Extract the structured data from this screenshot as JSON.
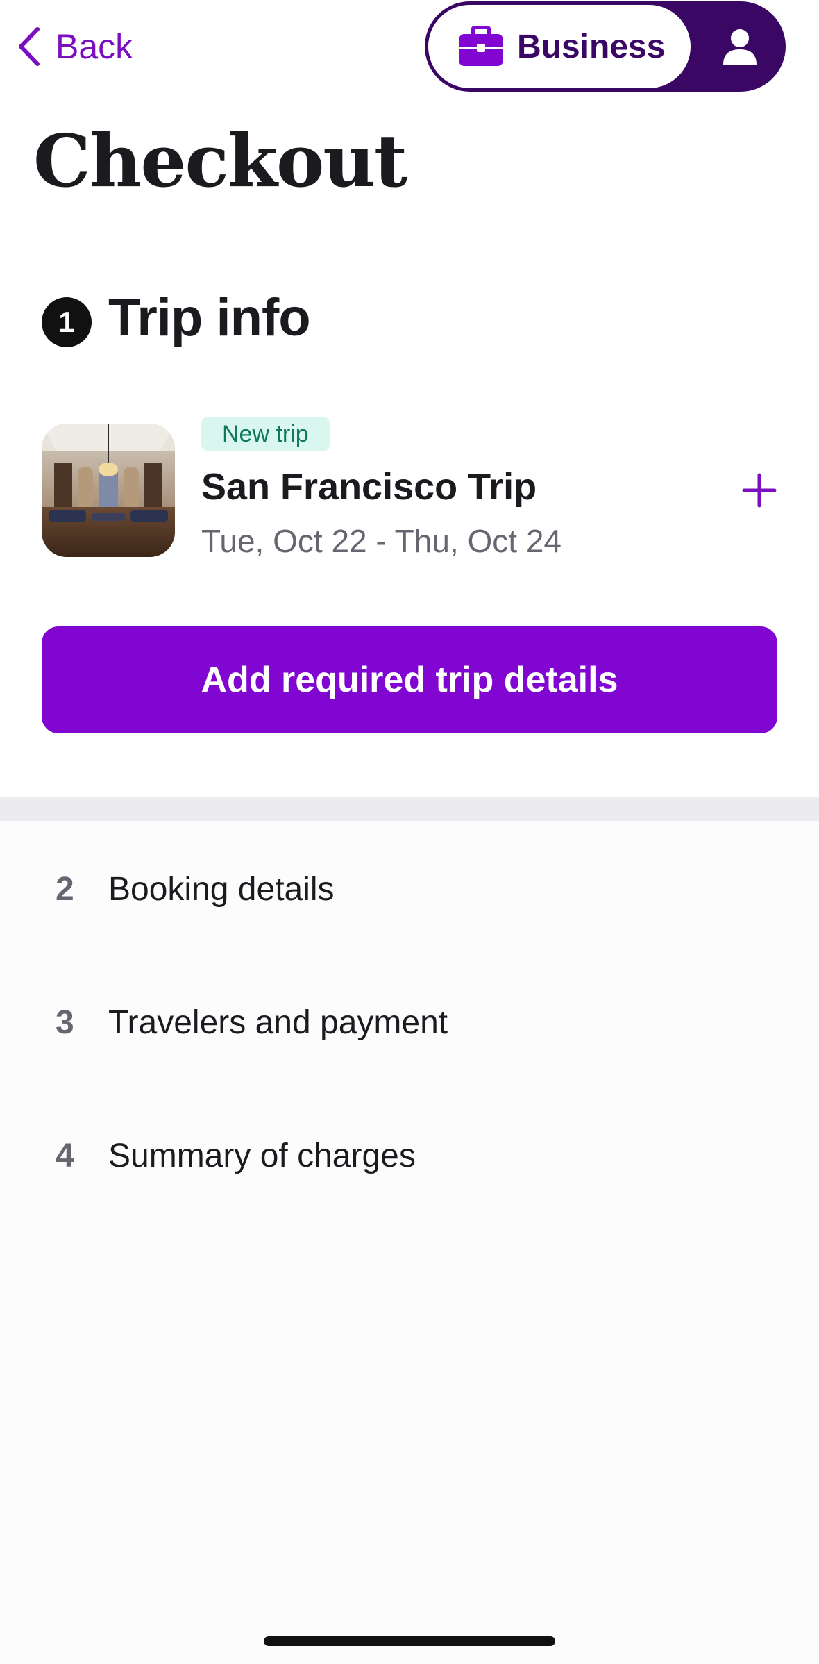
{
  "header": {
    "back_label": "Back",
    "mode_switch": {
      "business_label": "Business",
      "selected": "Business",
      "business_icon": "briefcase-icon",
      "personal_icon": "person-icon"
    }
  },
  "page_title": "Checkout",
  "trip_info": {
    "step_number": "1",
    "title": "Trip info",
    "trip": {
      "tag": "New trip",
      "name": "San Francisco Trip",
      "dates": "Tue, Oct 22 - Thu, Oct 24"
    },
    "add_icon": "plus-icon",
    "primary_button": "Add required trip details"
  },
  "steps": [
    {
      "number": "2",
      "label": "Booking details"
    },
    {
      "number": "3",
      "label": "Travelers and payment"
    },
    {
      "number": "4",
      "label": "Summary of charges"
    }
  ],
  "colors": {
    "accent": "#8106d2",
    "accent_dark": "#3b0764",
    "tag_bg": "#d9f7ee",
    "tag_text": "#0f7a5a",
    "muted_text": "#67656f",
    "divider": "#ecebf0"
  }
}
